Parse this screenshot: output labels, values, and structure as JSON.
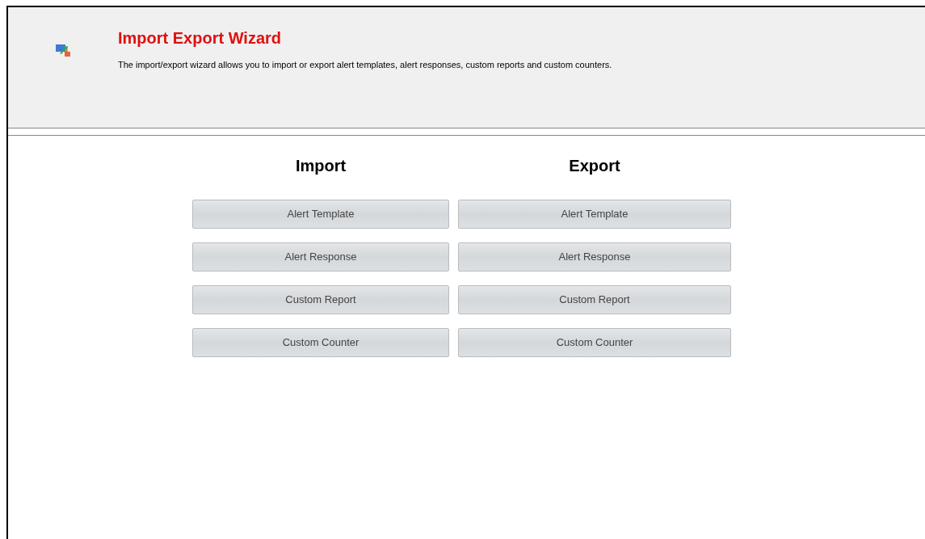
{
  "header": {
    "title": "Import Export Wizard",
    "description": "The import/export wizard allows you to import or export alert templates, alert responses, custom reports and custom counters."
  },
  "columns": [
    {
      "heading": "Import",
      "buttons": [
        "Alert Template",
        "Alert Response",
        "Custom Report",
        "Custom Counter"
      ]
    },
    {
      "heading": "Export",
      "buttons": [
        "Alert Template",
        "Alert Response",
        "Custom Report",
        "Custom Counter"
      ]
    }
  ]
}
